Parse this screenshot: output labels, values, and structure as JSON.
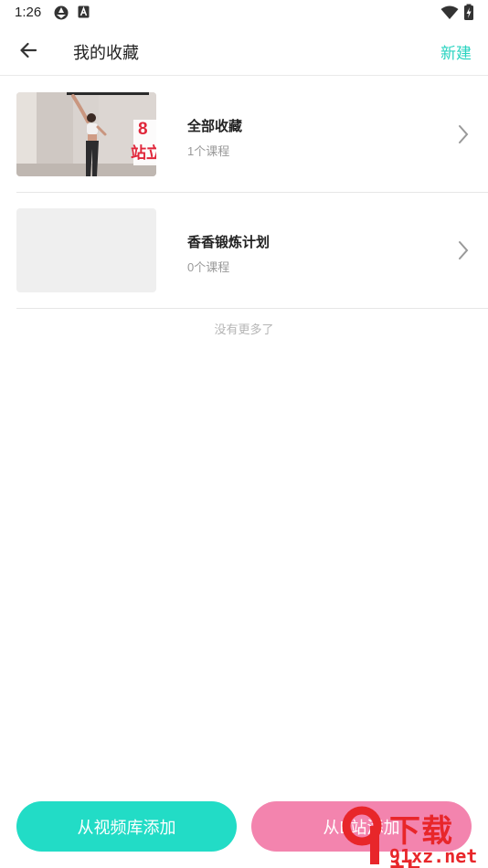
{
  "status_bar": {
    "time": "1:26"
  },
  "header": {
    "title": "我的收藏",
    "new_label": "新建"
  },
  "collections": [
    {
      "title": "全部收藏",
      "count": "1个课程",
      "thumb_text_1": "8",
      "thumb_text_2": "站立"
    },
    {
      "title": "香香锻炼计划",
      "count": "0个课程"
    }
  ],
  "footer_note": "没有更多了",
  "buttons": {
    "library": "从视频库添加",
    "bili": "从B站添加"
  },
  "watermark": {
    "brand": "下载站",
    "url": "91xz.net"
  },
  "colors": {
    "accent": "#29d3c0",
    "library_button": "#22dcc6",
    "bili_button": "#f384ae"
  }
}
